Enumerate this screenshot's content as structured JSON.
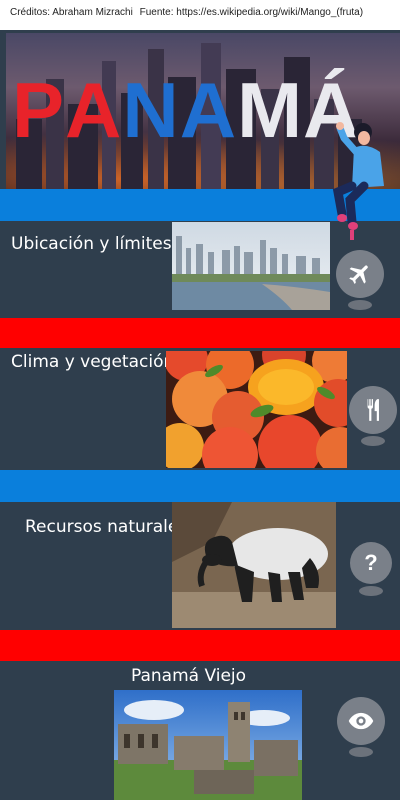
{
  "credits": {
    "author": "Créditos: Abraham Mizrachi",
    "source": "Fuente: https://es.wikipedia.org/wiki/Mango_(fruta)"
  },
  "hero": {
    "title_letters": [
      "P",
      "A",
      "N",
      "A",
      "M",
      "Á"
    ],
    "letter_colors": [
      "#e8232a",
      "#e8232a",
      "#1f6fd1",
      "#1f6fd1",
      "#e9e9ee",
      "#e9e9ee"
    ]
  },
  "sections": {
    "location": {
      "title": "Ubicación y límites",
      "icon": "airplane-icon"
    },
    "climate": {
      "title": "Clima y vegetación",
      "icon": "fork-knife-icon"
    },
    "resources": {
      "title": "Recursos naturales",
      "icon": "question-icon"
    },
    "old_panama": {
      "title": "Panamá Viejo",
      "icon": "eye-icon"
    }
  },
  "colors": {
    "background": "#2f3e4d",
    "blue_band": "#0a7fdc",
    "red_band": "#ff0000",
    "pin": "#7a8089"
  }
}
